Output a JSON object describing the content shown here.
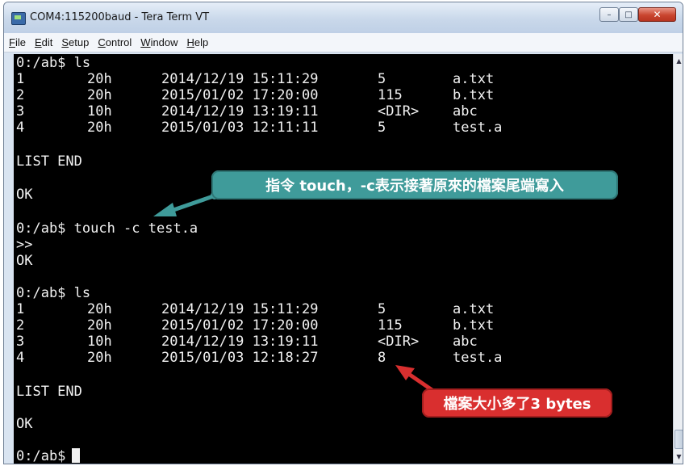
{
  "window": {
    "title": "COM4:115200baud - Tera Term VT",
    "min_glyph": "–",
    "max_glyph": "□",
    "close_glyph": "✕",
    "icon": "tera-term-icon"
  },
  "menu": [
    {
      "u": "F",
      "rest": "ile"
    },
    {
      "u": "E",
      "rest": "dit"
    },
    {
      "u": "S",
      "rest": "etup"
    },
    {
      "u": "C",
      "rest": "ontrol"
    },
    {
      "u": "W",
      "rest": "indow"
    },
    {
      "u": "H",
      "rest": "elp"
    }
  ],
  "terminal": {
    "cmd1": "0:/ab$ ls",
    "list1": [
      {
        "num": "1",
        "attr": "20h",
        "date": "2014/12/19 15:11:29",
        "size": "5",
        "name": "a.txt"
      },
      {
        "num": "2",
        "attr": "20h",
        "date": "2015/01/02 17:20:00",
        "size": "115",
        "name": "b.txt"
      },
      {
        "num": "3",
        "attr": "10h",
        "date": "2014/12/19 13:19:11",
        "size": "<DIR>",
        "name": "abc"
      },
      {
        "num": "4",
        "attr": "20h",
        "date": "2015/01/03 12:11:11",
        "size": "5",
        "name": "test.a"
      }
    ],
    "list_end1": "LIST END",
    "ok1": "OK",
    "cmd2": "0:/ab$ touch -c test.a",
    "prompt_gt": ">>",
    "ok2": "OK",
    "cmd3": "0:/ab$ ls",
    "list2": [
      {
        "num": "1",
        "attr": "20h",
        "date": "2014/12/19 15:11:29",
        "size": "5",
        "name": "a.txt"
      },
      {
        "num": "2",
        "attr": "20h",
        "date": "2015/01/02 17:20:00",
        "size": "115",
        "name": "b.txt"
      },
      {
        "num": "3",
        "attr": "10h",
        "date": "2014/12/19 13:19:11",
        "size": "<DIR>",
        "name": "abc"
      },
      {
        "num": "4",
        "attr": "20h",
        "date": "2015/01/03 12:18:27",
        "size": "8",
        "name": "test.a"
      }
    ],
    "list_end2": "LIST END",
    "ok3": "OK",
    "prompt_final": "0:/ab$"
  },
  "annotations": {
    "touch_note": "指令 touch，-c表示接著原來的檔案尾端寫入",
    "size_note": "檔案大小多了3 bytes",
    "touch_color": "#3f9b9a",
    "size_color": "#d92f2f"
  },
  "scrollbar": {
    "up_glyph": "▲",
    "down_glyph": "▼"
  }
}
